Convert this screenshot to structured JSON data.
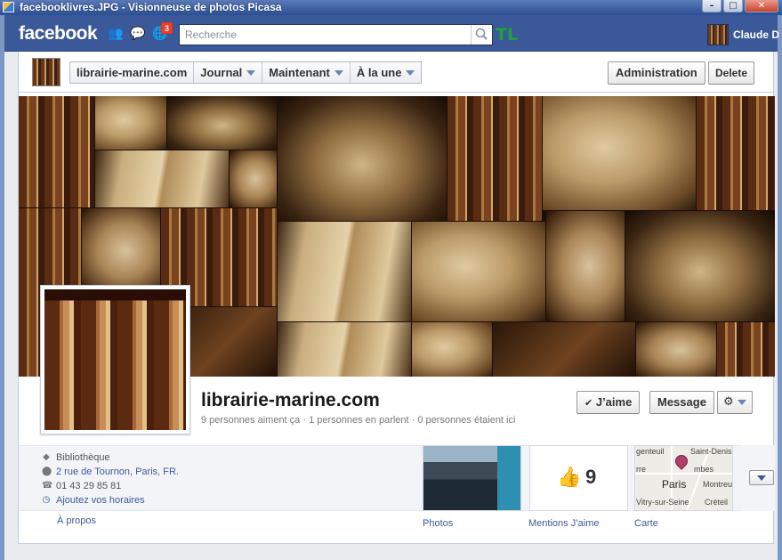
{
  "window": {
    "title": "facebooklivres.JPG - Visionneuse de photos Picasa",
    "buttons": [
      "–",
      "□",
      "✕"
    ]
  },
  "fbbar": {
    "logo": "facebook",
    "notification_count": "3",
    "search_placeholder": "Recherche",
    "extension_label": "TL",
    "user_name": "Claude D"
  },
  "pagebar": {
    "tabs": [
      {
        "label": "librairie-marine.com",
        "has_caret": false
      },
      {
        "label": "Journal",
        "has_caret": true
      },
      {
        "label": "Maintenant",
        "has_caret": true
      },
      {
        "label": "À la une",
        "has_caret": true
      }
    ],
    "admin_label": "Administration",
    "delete_label": "Delete"
  },
  "profile": {
    "name": "librairie-marine.com",
    "stats": "9 personnes aiment ça · 1 personnes en parlent · 0 personnes étaient ici",
    "like_label": "J’aime",
    "message_label": "Message"
  },
  "about": {
    "category": "Bibliothèque",
    "address": "2 rue de Tournon, Paris, FR.",
    "phone": "01 43 29 85 81",
    "hours_link": "Ajoutez vos horaires",
    "about_link": "À propos"
  },
  "apps": {
    "photos_label": "Photos",
    "likes_label": "Mentions J’aime",
    "likes_count": "9",
    "map_label": "Carte",
    "map_places": {
      "top_left": "genteuil",
      "top_right": "Saint-Denis",
      "mid_left": "rre",
      "mid_right": "mbes",
      "center": "Paris",
      "right": "Montreu",
      "bottom_left": "Vitry-sur-Seine",
      "bottom_right": "Créteil"
    }
  }
}
